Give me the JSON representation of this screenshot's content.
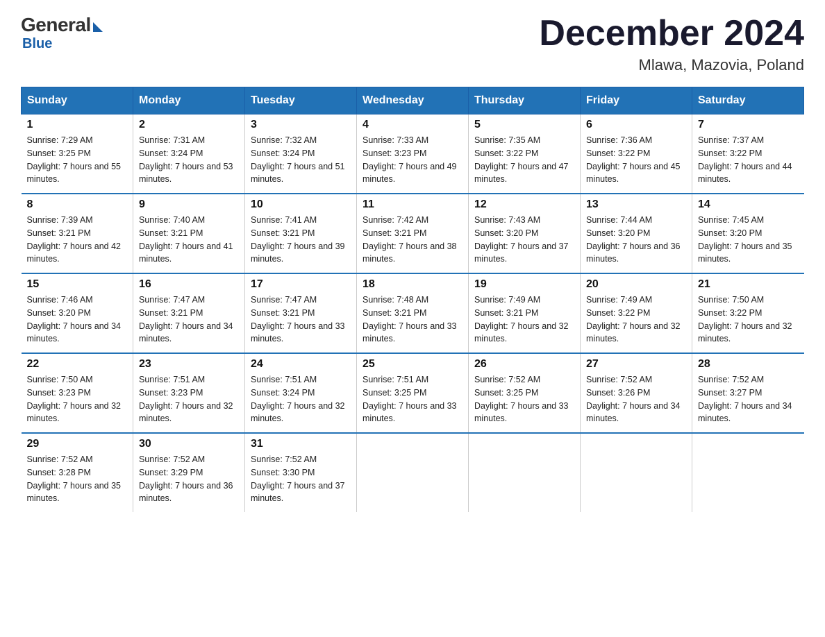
{
  "logo": {
    "general": "General",
    "blue": "Blue"
  },
  "title": "December 2024",
  "location": "Mlawa, Mazovia, Poland",
  "days_of_week": [
    "Sunday",
    "Monday",
    "Tuesday",
    "Wednesday",
    "Thursday",
    "Friday",
    "Saturday"
  ],
  "weeks": [
    [
      {
        "day": "1",
        "sunrise": "7:29 AM",
        "sunset": "3:25 PM",
        "daylight": "7 hours and 55 minutes."
      },
      {
        "day": "2",
        "sunrise": "7:31 AM",
        "sunset": "3:24 PM",
        "daylight": "7 hours and 53 minutes."
      },
      {
        "day": "3",
        "sunrise": "7:32 AM",
        "sunset": "3:24 PM",
        "daylight": "7 hours and 51 minutes."
      },
      {
        "day": "4",
        "sunrise": "7:33 AM",
        "sunset": "3:23 PM",
        "daylight": "7 hours and 49 minutes."
      },
      {
        "day": "5",
        "sunrise": "7:35 AM",
        "sunset": "3:22 PM",
        "daylight": "7 hours and 47 minutes."
      },
      {
        "day": "6",
        "sunrise": "7:36 AM",
        "sunset": "3:22 PM",
        "daylight": "7 hours and 45 minutes."
      },
      {
        "day": "7",
        "sunrise": "7:37 AM",
        "sunset": "3:22 PM",
        "daylight": "7 hours and 44 minutes."
      }
    ],
    [
      {
        "day": "8",
        "sunrise": "7:39 AM",
        "sunset": "3:21 PM",
        "daylight": "7 hours and 42 minutes."
      },
      {
        "day": "9",
        "sunrise": "7:40 AM",
        "sunset": "3:21 PM",
        "daylight": "7 hours and 41 minutes."
      },
      {
        "day": "10",
        "sunrise": "7:41 AM",
        "sunset": "3:21 PM",
        "daylight": "7 hours and 39 minutes."
      },
      {
        "day": "11",
        "sunrise": "7:42 AM",
        "sunset": "3:21 PM",
        "daylight": "7 hours and 38 minutes."
      },
      {
        "day": "12",
        "sunrise": "7:43 AM",
        "sunset": "3:20 PM",
        "daylight": "7 hours and 37 minutes."
      },
      {
        "day": "13",
        "sunrise": "7:44 AM",
        "sunset": "3:20 PM",
        "daylight": "7 hours and 36 minutes."
      },
      {
        "day": "14",
        "sunrise": "7:45 AM",
        "sunset": "3:20 PM",
        "daylight": "7 hours and 35 minutes."
      }
    ],
    [
      {
        "day": "15",
        "sunrise": "7:46 AM",
        "sunset": "3:20 PM",
        "daylight": "7 hours and 34 minutes."
      },
      {
        "day": "16",
        "sunrise": "7:47 AM",
        "sunset": "3:21 PM",
        "daylight": "7 hours and 34 minutes."
      },
      {
        "day": "17",
        "sunrise": "7:47 AM",
        "sunset": "3:21 PM",
        "daylight": "7 hours and 33 minutes."
      },
      {
        "day": "18",
        "sunrise": "7:48 AM",
        "sunset": "3:21 PM",
        "daylight": "7 hours and 33 minutes."
      },
      {
        "day": "19",
        "sunrise": "7:49 AM",
        "sunset": "3:21 PM",
        "daylight": "7 hours and 32 minutes."
      },
      {
        "day": "20",
        "sunrise": "7:49 AM",
        "sunset": "3:22 PM",
        "daylight": "7 hours and 32 minutes."
      },
      {
        "day": "21",
        "sunrise": "7:50 AM",
        "sunset": "3:22 PM",
        "daylight": "7 hours and 32 minutes."
      }
    ],
    [
      {
        "day": "22",
        "sunrise": "7:50 AM",
        "sunset": "3:23 PM",
        "daylight": "7 hours and 32 minutes."
      },
      {
        "day": "23",
        "sunrise": "7:51 AM",
        "sunset": "3:23 PM",
        "daylight": "7 hours and 32 minutes."
      },
      {
        "day": "24",
        "sunrise": "7:51 AM",
        "sunset": "3:24 PM",
        "daylight": "7 hours and 32 minutes."
      },
      {
        "day": "25",
        "sunrise": "7:51 AM",
        "sunset": "3:25 PM",
        "daylight": "7 hours and 33 minutes."
      },
      {
        "day": "26",
        "sunrise": "7:52 AM",
        "sunset": "3:25 PM",
        "daylight": "7 hours and 33 minutes."
      },
      {
        "day": "27",
        "sunrise": "7:52 AM",
        "sunset": "3:26 PM",
        "daylight": "7 hours and 34 minutes."
      },
      {
        "day": "28",
        "sunrise": "7:52 AM",
        "sunset": "3:27 PM",
        "daylight": "7 hours and 34 minutes."
      }
    ],
    [
      {
        "day": "29",
        "sunrise": "7:52 AM",
        "sunset": "3:28 PM",
        "daylight": "7 hours and 35 minutes."
      },
      {
        "day": "30",
        "sunrise": "7:52 AM",
        "sunset": "3:29 PM",
        "daylight": "7 hours and 36 minutes."
      },
      {
        "day": "31",
        "sunrise": "7:52 AM",
        "sunset": "3:30 PM",
        "daylight": "7 hours and 37 minutes."
      },
      null,
      null,
      null,
      null
    ]
  ]
}
